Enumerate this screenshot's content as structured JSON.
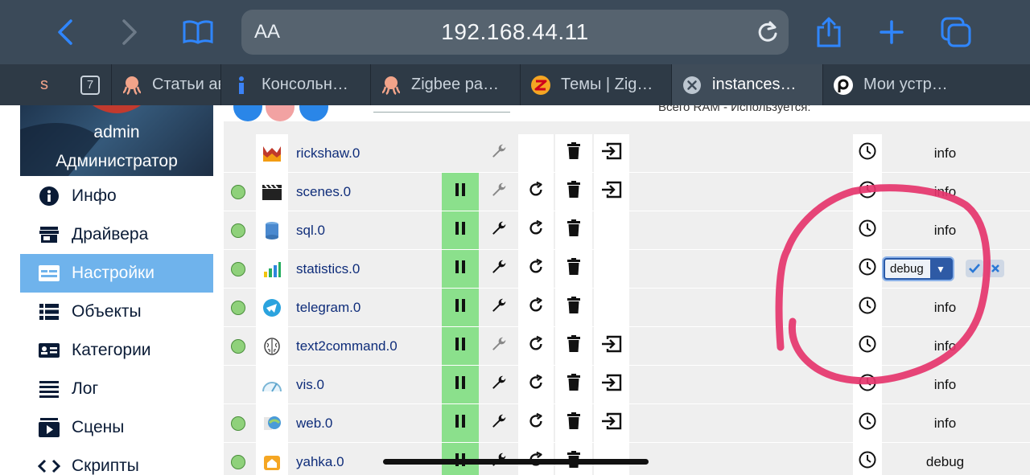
{
  "browser": {
    "aa_label": "AA",
    "url": "192.168.44.11"
  },
  "tabs": [
    {
      "label": "Статьи ав",
      "icon": "octopus-icon"
    },
    {
      "label": "Консольн…",
      "icon": "info-icon"
    },
    {
      "label": "Zigbee ра…",
      "icon": "octopus-icon"
    },
    {
      "label": "Темы | Zig…",
      "icon": "z-logo-icon"
    },
    {
      "label": "instances…",
      "icon": "close-icon"
    },
    {
      "label": "Мои устр…",
      "icon": "p-logo-icon"
    }
  ],
  "tab_count": "7",
  "sidebar": {
    "user_name": "admin",
    "user_role": "Администратор",
    "items": [
      {
        "label": "Инфо",
        "icon": "info-icon"
      },
      {
        "label": "Драйвера",
        "icon": "store-icon"
      },
      {
        "label": "Настройки",
        "icon": "settings-card-icon"
      },
      {
        "label": "Объекты",
        "icon": "list-icon"
      },
      {
        "label": "Категории",
        "icon": "category-icon"
      },
      {
        "label": "Лог",
        "icon": "log-lines-icon"
      },
      {
        "label": "Сцены",
        "icon": "scenes-icon"
      },
      {
        "label": "Скрипты",
        "icon": "code-icon"
      }
    ]
  },
  "instances": [
    {
      "name": "rickshaw.0",
      "status": false,
      "pause": false,
      "restart": false,
      "link": true,
      "log": "info",
      "icon": "rickshaw-icon",
      "wrench_active": false
    },
    {
      "name": "scenes.0",
      "status": true,
      "pause": true,
      "restart": true,
      "link": true,
      "log": "info",
      "icon": "clapper-icon",
      "wrench_active": false
    },
    {
      "name": "sql.0",
      "status": true,
      "pause": true,
      "restart": true,
      "link": false,
      "log": "info",
      "icon": "database-icon",
      "wrench_active": true
    },
    {
      "name": "statistics.0",
      "status": true,
      "pause": true,
      "restart": true,
      "link": false,
      "log": "debug",
      "icon": "bar-chart-icon",
      "wrench_active": true,
      "editing": true
    },
    {
      "name": "telegram.0",
      "status": true,
      "pause": true,
      "restart": true,
      "link": false,
      "log": "info",
      "icon": "telegram-icon",
      "wrench_active": true
    },
    {
      "name": "text2command.0",
      "status": true,
      "pause": true,
      "restart": true,
      "link": true,
      "log": "info",
      "icon": "brain-icon",
      "wrench_active": false
    },
    {
      "name": "vis.0",
      "status": false,
      "pause": true,
      "restart": true,
      "link": true,
      "log": "info",
      "icon": "gauge-icon",
      "wrench_active": true
    },
    {
      "name": "web.0",
      "status": true,
      "pause": true,
      "restart": true,
      "link": true,
      "log": "info",
      "icon": "globe-icon",
      "wrench_active": true
    },
    {
      "name": "yahka.0",
      "status": true,
      "pause": true,
      "restart": true,
      "link": false,
      "log": "debug",
      "icon": "home-icon",
      "wrench_active": true
    }
  ],
  "top_strip_text": "Всего RAM - Используется: ",
  "colors": {
    "browser_bar": "#3b4a59",
    "accent_blue": "#1f6fe0",
    "nav_active": "#6fb3ec",
    "pause_green": "#8be08c",
    "annotation": "#e5356c"
  }
}
